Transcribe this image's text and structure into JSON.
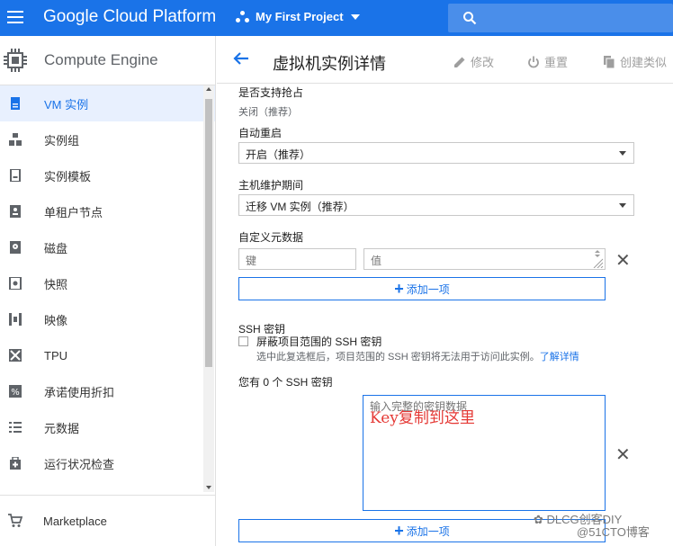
{
  "topbar": {
    "brand": "Google Cloud Platform",
    "project": "My First Project",
    "icons": [
      "menu-icon",
      "project-dots-icon",
      "chevron-down-icon",
      "search-icon"
    ]
  },
  "sidebar": {
    "title": "Compute Engine",
    "items": [
      {
        "label": "VM 实例",
        "icon": "vm-instances-icon",
        "active": true
      },
      {
        "label": "实例组",
        "icon": "instance-groups-icon"
      },
      {
        "label": "实例模板",
        "icon": "instance-templates-icon"
      },
      {
        "label": "单租户节点",
        "icon": "sole-tenant-nodes-icon"
      },
      {
        "label": "磁盘",
        "icon": "disks-icon"
      },
      {
        "label": "快照",
        "icon": "snapshots-icon"
      },
      {
        "label": "映像",
        "icon": "images-icon"
      },
      {
        "label": "TPU",
        "icon": "tpu-icon"
      },
      {
        "label": "承诺使用折扣",
        "icon": "committed-use-icon"
      },
      {
        "label": "元数据",
        "icon": "metadata-icon"
      },
      {
        "label": "运行状况检查",
        "icon": "health-checks-icon"
      }
    ],
    "marketplace": "Marketplace"
  },
  "page": {
    "title": "虚拟机实例详情",
    "actions": {
      "edit": "修改",
      "reset": "重置",
      "create_similar": "创建类似"
    },
    "preemptible": {
      "label": "是否支持抢占",
      "value": "关闭（推荐）"
    },
    "auto_restart": {
      "label": "自动重启",
      "value": "开启（推荐）"
    },
    "maintenance": {
      "label": "主机维护期间",
      "value": "迁移 VM 实例（推荐）"
    },
    "custom_metadata": {
      "label": "自定义元数据",
      "key_placeholder": "键",
      "value_placeholder": "值",
      "add": "添加一项"
    },
    "ssh": {
      "label": "SSH 密钥",
      "block_label": "屏蔽项目范围的 SSH 密钥",
      "block_hint": "选中此复选框后，项目范围的 SSH 密钥将无法用于访问此实例。",
      "learn_more": "了解详情",
      "count_text": "您有 0 个 SSH 密钥",
      "key_placeholder": "输入完整的密钥数据",
      "annotation": "Key复制到这里",
      "add": "添加一项"
    }
  },
  "watermark": {
    "line1": "DLCG创客DIY",
    "line2": "@51CTO博客"
  },
  "colors": {
    "brand": "#1a73e8",
    "active_bg": "#e8f0fe",
    "annotation": "#e53935"
  }
}
